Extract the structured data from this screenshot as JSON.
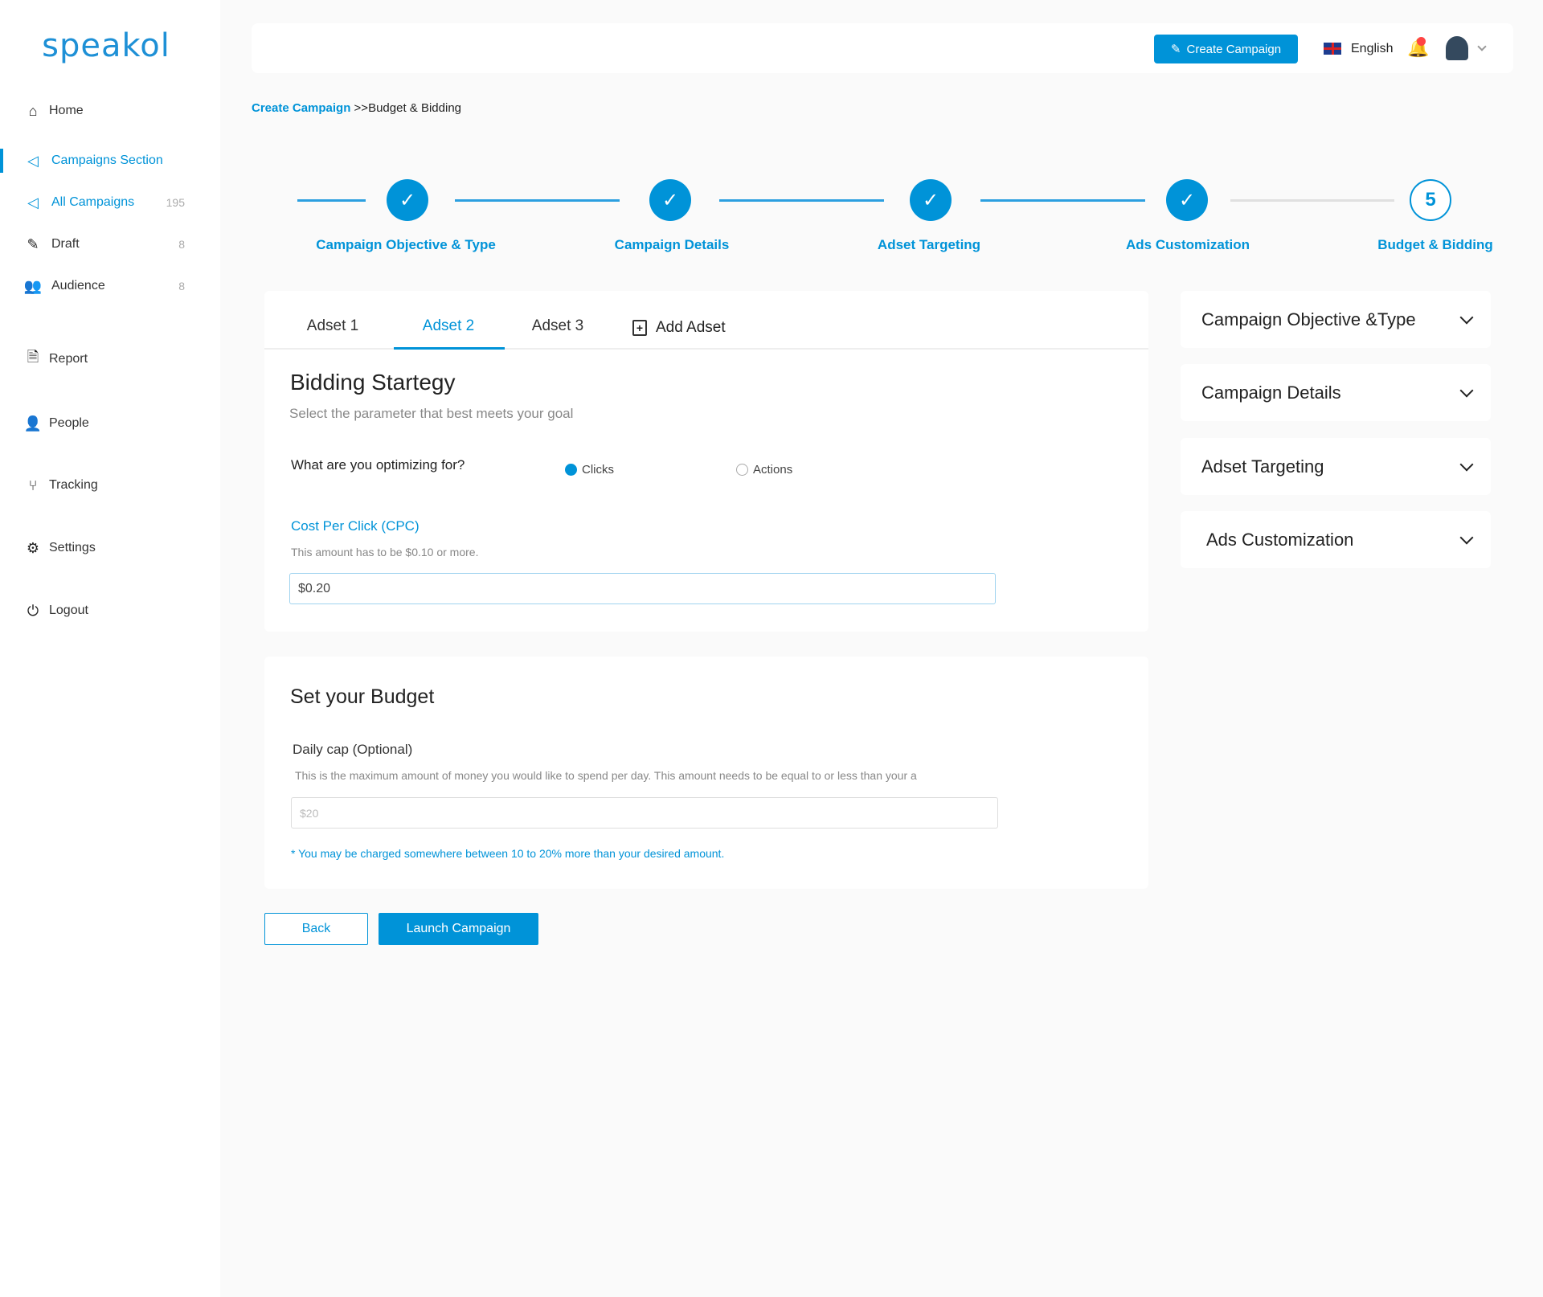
{
  "brand": {
    "logo": "speakol",
    "accent": "#0093d8"
  },
  "sidebar": {
    "items": [
      {
        "label": "Home",
        "icon": "home-icon"
      },
      {
        "label": "Campaigns Section",
        "icon": "megaphone-icon",
        "active": true
      },
      {
        "label": "All Campaigns",
        "icon": "megaphone-icon",
        "count": "195",
        "active": true
      },
      {
        "label": "Draft",
        "icon": "pencil-icon",
        "count": "8"
      },
      {
        "label": "Audience",
        "icon": "group-icon",
        "count": "8"
      },
      {
        "label": "Report",
        "icon": "report-icon"
      },
      {
        "label": "People",
        "icon": "person-icon"
      },
      {
        "label": "Tracking",
        "icon": "branch-icon"
      },
      {
        "label": "Settings",
        "icon": "gear-icon"
      },
      {
        "label": "Logout",
        "icon": "power-icon"
      }
    ]
  },
  "topbar": {
    "create_label": "Create Campaign",
    "language": "English"
  },
  "breadcrumb": {
    "root": "Create Campaign",
    "sep": ">>",
    "current": "Budget & Bidding"
  },
  "stepper": {
    "steps": [
      {
        "label": "Campaign Objective & Type",
        "done": true
      },
      {
        "label": "Campaign Details",
        "done": true
      },
      {
        "label": "Adset Targeting",
        "done": true
      },
      {
        "label": "Ads Customization",
        "done": true
      },
      {
        "label": "Budget & Bidding",
        "number": "5",
        "current": true
      }
    ]
  },
  "tabs": [
    {
      "label": "Adset 1"
    },
    {
      "label": "Adset 2",
      "active": true
    },
    {
      "label": "Adset 3"
    },
    {
      "label": "Add Adset"
    }
  ],
  "bidding": {
    "title": "Bidding Startegy",
    "subtitle": "Select the parameter that  best meets your goal",
    "question": "What are you optimizing for?",
    "options": [
      "Clicks",
      "Actions"
    ],
    "selected": "Clicks",
    "cpc_label": "Cost Per Click (CPC)",
    "cpc_help": "This amount has to be $0.10 or more.",
    "cpc_value": "$0.20"
  },
  "budget": {
    "title": "Set your Budget",
    "daily_label": "Daily cap (Optional)",
    "daily_help": "This is the maximum amount of money you would like to spend per day. This amount  needs to be equal to or less than your a",
    "daily_placeholder": "$20",
    "note": "* You may be charged  somewhere between  10 to 20% more than your desired  amount."
  },
  "actions": {
    "back": "Back",
    "launch": "Launch Campaign"
  },
  "summary": [
    {
      "label": "Campaign Objective &Type"
    },
    {
      "label": "Campaign Details"
    },
    {
      "label": "Adset Targeting"
    },
    {
      "label": "Ads Customization"
    }
  ]
}
